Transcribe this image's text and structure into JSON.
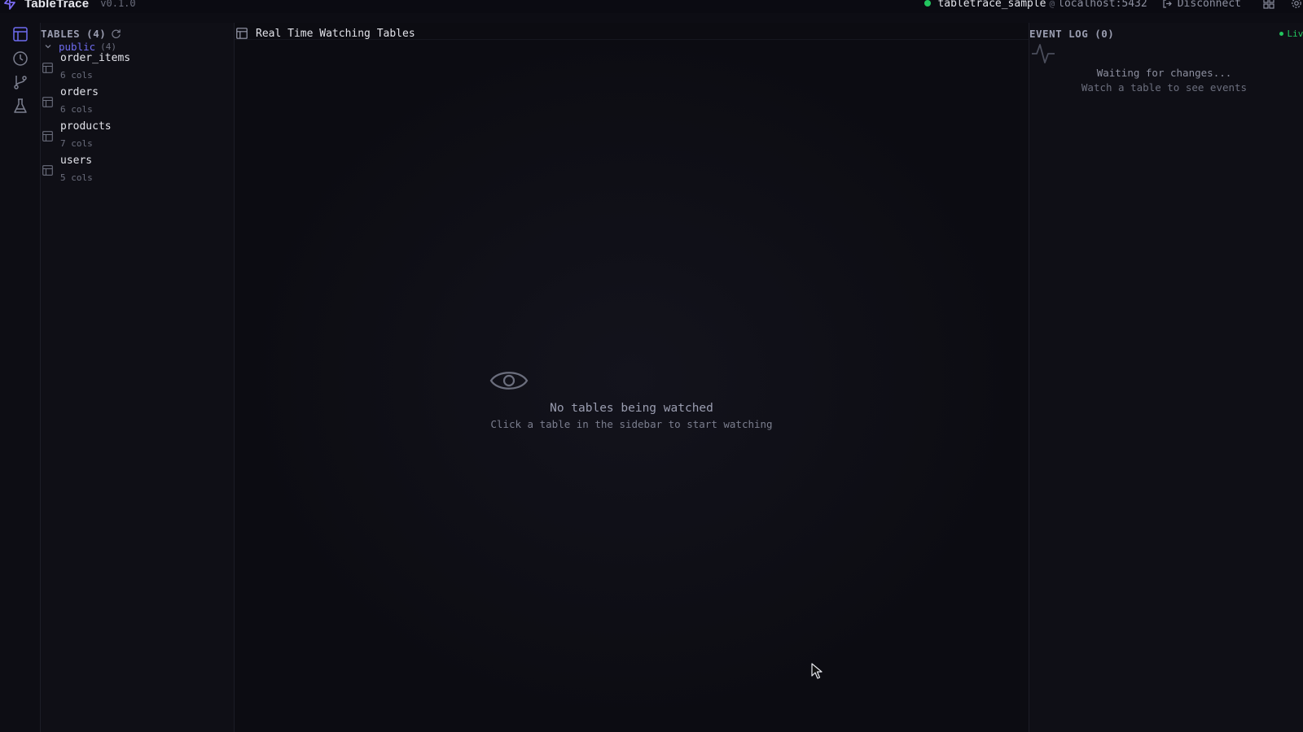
{
  "app": {
    "name": "TableTrace",
    "version": "v0.1.0"
  },
  "connection": {
    "database": "tabletrace_sample",
    "separator": "@",
    "host": "localhost:5432",
    "disconnect_label": "Disconnect",
    "status_color": "#22c55e"
  },
  "rail": {
    "items": [
      "tables-icon",
      "history-icon",
      "branch-icon",
      "flask-icon"
    ]
  },
  "sidebar": {
    "title": "TABLES (4)",
    "schema": {
      "name": "public",
      "count": "(4)"
    },
    "tables": [
      {
        "name": "order_items",
        "cols": "6 cols"
      },
      {
        "name": "orders",
        "cols": "6 cols"
      },
      {
        "name": "products",
        "cols": "7 cols"
      },
      {
        "name": "users",
        "cols": "5 cols"
      }
    ]
  },
  "main": {
    "title": "Real Time Watching Tables",
    "empty_title": "No tables being watched",
    "empty_subtitle": "Click a table in the sidebar to start watching"
  },
  "event_log": {
    "title": "EVENT LOG (0)",
    "live_label": "Live",
    "waiting": "Waiting for changes...",
    "hint": "Watch a table to see events"
  },
  "colors": {
    "accent": "#6f6cf0",
    "live": "#22c55e",
    "background": "#0d0d14"
  }
}
